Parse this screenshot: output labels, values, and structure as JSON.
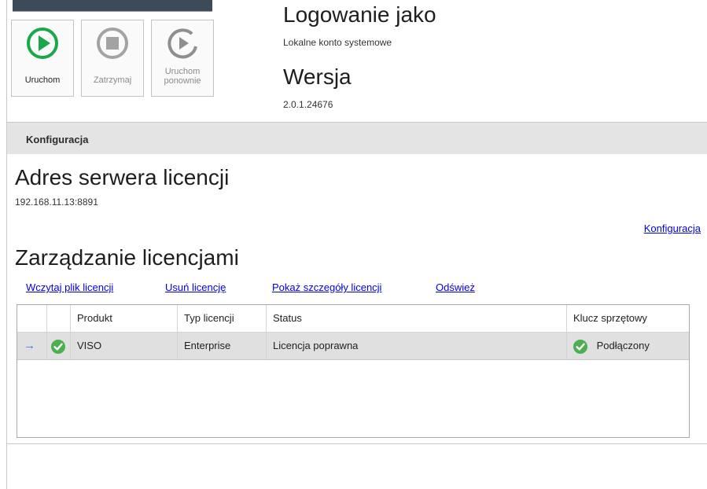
{
  "service": {
    "start_label": "Uruchom",
    "stop_label": "Zatrzymaj",
    "restart_label_line1": "Uruchom",
    "restart_label_line2": "ponownie"
  },
  "info": {
    "login_heading": "Logowanie jako",
    "login_value": "Lokalne konto systemowe",
    "version_heading": "Wersja",
    "version_value": "2.0.1.24676"
  },
  "config": {
    "section_title": "Konfiguracja",
    "server_heading": "Adres serwera licencji",
    "server_value": "192.168.11.13:8891",
    "config_link": "Konfiguracja"
  },
  "licenses": {
    "heading": "Zarządzanie licencjami",
    "actions": {
      "load": "Wczytaj plik licencji",
      "remove": "Usuń licencję",
      "details": "Pokaż szczegóły licencji",
      "refresh": "Odśwież"
    },
    "columns": {
      "product": "Produkt",
      "type": "Typ licencji",
      "status": "Status",
      "key": "Klucz sprzętowy"
    },
    "rows": [
      {
        "product": "VISO",
        "type": "Enterprise",
        "status": "Licencja poprawna",
        "key": "Podłączony"
      }
    ]
  },
  "colors": {
    "start_green": "#1aa84a",
    "ok_green": "#4caf50",
    "link_blue": "#0000ee"
  }
}
